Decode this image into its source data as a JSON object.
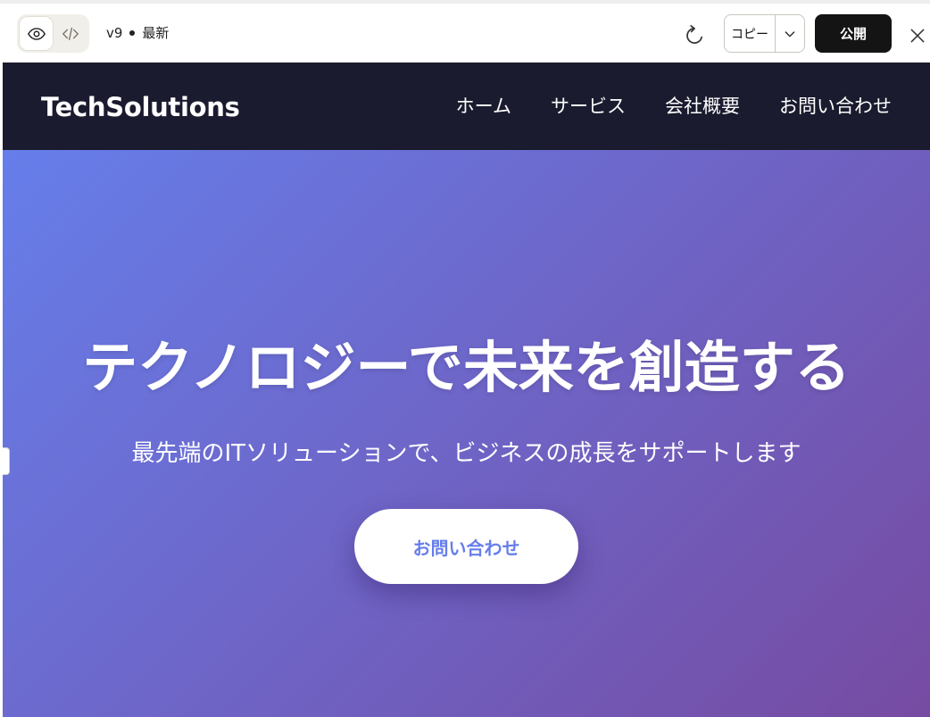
{
  "toolbar": {
    "preview_icon": "eye-icon",
    "code_icon": "code-icon",
    "version": "v9",
    "version_status": "最新",
    "refresh_icon": "refresh-icon",
    "copy_label": "コピー",
    "copy_dropdown_icon": "chevron-down-icon",
    "publish_label": "公開",
    "close_icon": "close-icon"
  },
  "site": {
    "logo": "TechSolutions",
    "nav": [
      {
        "label": "ホーム"
      },
      {
        "label": "サービス"
      },
      {
        "label": "会社概要"
      },
      {
        "label": "お問い合わせ"
      }
    ],
    "hero": {
      "title": "テクノロジーで未来を創造する",
      "subtitle": "最先端のITソリューションで、ビジネスの成長をサポートします",
      "cta_label": "お問い合わせ"
    }
  },
  "colors": {
    "nav_background": "#1a1b2e",
    "hero_gradient_start": "#667eea",
    "hero_gradient_end": "#764ba2",
    "publish_button": "#141414",
    "cta_text": "#667eea"
  }
}
